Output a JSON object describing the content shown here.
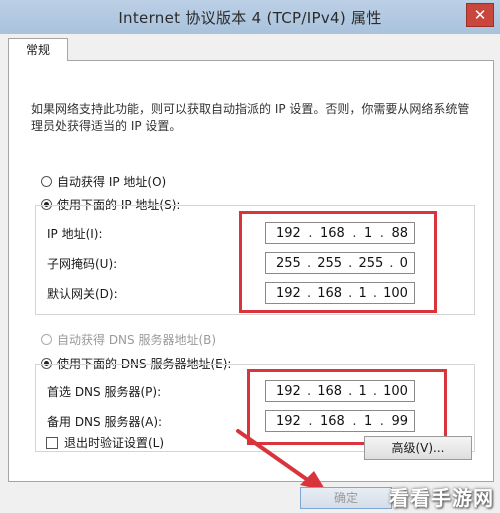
{
  "window": {
    "title": "Internet 协议版本 4 (TCP/IPv4) 属性",
    "close_symbol": "✕"
  },
  "tabs": [
    {
      "label": "常规",
      "active": true
    }
  ],
  "description": "如果网络支持此功能，则可以获取自动指派的 IP 设置。否则，你需要从网络系统管理员处获得适当的 IP 设置。",
  "ip_section": {
    "auto_label": "自动获得 IP 地址(O)",
    "manual_label": "使用下面的 IP 地址(S):",
    "selected": "manual",
    "fields": [
      {
        "label": "IP 地址(I):",
        "octets": [
          "192",
          "168",
          "1",
          "88"
        ]
      },
      {
        "label": "子网掩码(U):",
        "octets": [
          "255",
          "255",
          "255",
          "0"
        ]
      },
      {
        "label": "默认网关(D):",
        "octets": [
          "192",
          "168",
          "1",
          "100"
        ]
      }
    ]
  },
  "dns_section": {
    "auto_label": "自动获得 DNS 服务器地址(B)",
    "manual_label": "使用下面的 DNS 服务器地址(E):",
    "selected": "manual",
    "fields": [
      {
        "label": "首选 DNS 服务器(P):",
        "octets": [
          "192",
          "168",
          "1",
          "100"
        ]
      },
      {
        "label": "备用 DNS 服务器(A):",
        "octets": [
          "192",
          "168",
          "1",
          "99"
        ]
      }
    ]
  },
  "validate_on_exit": {
    "label": "退出时验证设置(L)",
    "checked": false
  },
  "buttons": {
    "advanced": "高级(V)...",
    "ok": "确定"
  },
  "watermark": "看看手游网",
  "colors": {
    "highlight": "#d9333c",
    "titlebar": "#b4cae2"
  }
}
